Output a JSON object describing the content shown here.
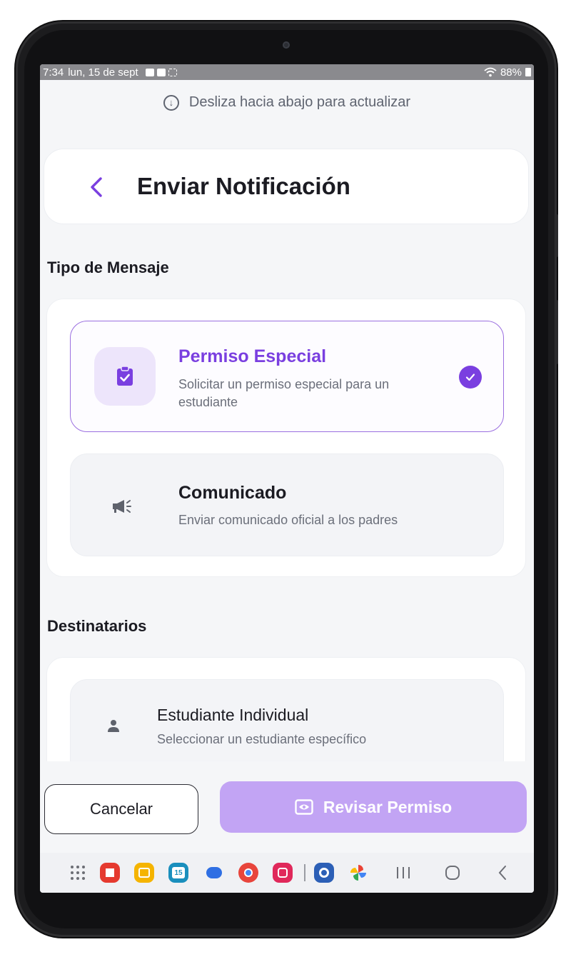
{
  "status_bar": {
    "time": "7:34",
    "date": "lun, 15 de sept",
    "battery": "88%"
  },
  "refresh_hint": "Desliza hacia abajo para actualizar",
  "header": {
    "title": "Enviar Notificación"
  },
  "message_type": {
    "section_title": "Tipo de Mensaje",
    "options": [
      {
        "title": "Permiso Especial",
        "description": "Solicitar un permiso especial para un estudiante",
        "icon": "clipboard-check-icon",
        "selected": true
      },
      {
        "title": "Comunicado",
        "description": "Enviar comunicado oficial a los padres",
        "icon": "megaphone-icon",
        "selected": false
      }
    ]
  },
  "recipients": {
    "section_title": "Destinatarios",
    "options": [
      {
        "title": "Estudiante Individual",
        "description": "Seleccionar un estudiante específico",
        "icon": "person-icon"
      }
    ]
  },
  "footer": {
    "cancel_label": "Cancelar",
    "review_label": "Revisar Permiso"
  },
  "nav_bar": {
    "calendar_day": "15",
    "apps": [
      "app-drawer-icon",
      "flipboard-icon",
      "notes-icon",
      "calendar-icon",
      "messages-icon",
      "chrome-icon",
      "screen-recorder-icon",
      "settings-icon",
      "photos-icon"
    ],
    "system": [
      "recents-icon",
      "home-icon",
      "back-icon"
    ]
  },
  "colors": {
    "accent": "#7a3fe0",
    "accent_light": "#ede5fb",
    "button_disabled": "#c2a4f4"
  }
}
